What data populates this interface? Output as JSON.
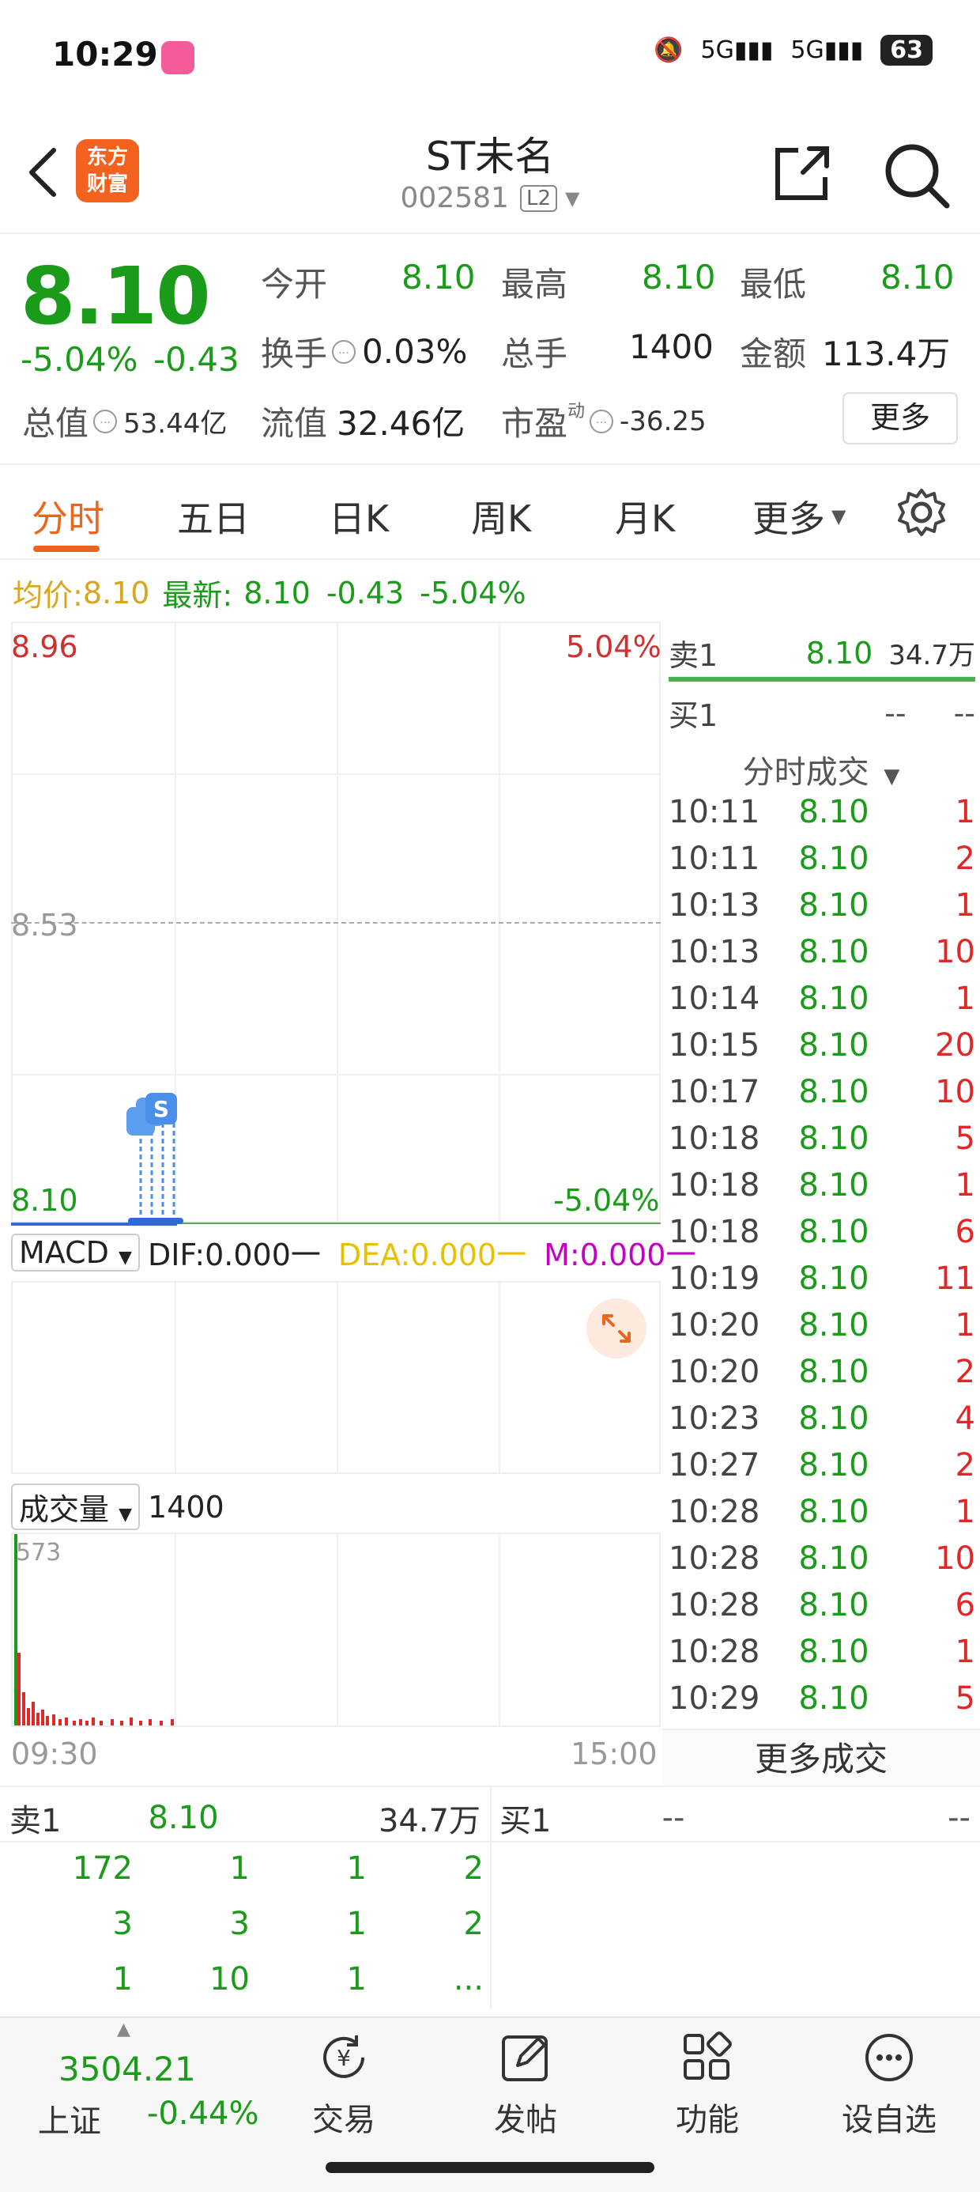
{
  "status": {
    "time": "10:29",
    "net1": "5G",
    "net2": "5G",
    "battery": "63"
  },
  "header": {
    "logo_line1": "东方",
    "logo_line2": "财富",
    "name": "ST未名",
    "code": "002581",
    "level_badge": "L2"
  },
  "quote": {
    "price": "8.10",
    "change_pct": "-5.04%",
    "change_abs": "-0.43",
    "open_label": "今开",
    "open": "8.10",
    "high_label": "最高",
    "high": "8.10",
    "low_label": "最低",
    "low": "8.10",
    "turnover_label": "换手",
    "turnover": "0.03%",
    "volume_label": "总手",
    "volume": "1400",
    "amount_label": "金额",
    "amount": "113.4万",
    "total_cap_label": "总值",
    "total_cap": "53.44亿",
    "float_cap_label": "流值",
    "float_cap": "32.46亿",
    "pe_label": "市盈",
    "pe_sup": "动",
    "pe": "-36.25",
    "more_button": "更多"
  },
  "tabs": [
    "分时",
    "五日",
    "日K",
    "周K",
    "月K",
    "更多"
  ],
  "avg_line": {
    "avg_label": "均价:",
    "avg_value": "8.10",
    "latest_label": "最新:",
    "latest_value": "8.10",
    "latest_change": "-0.43",
    "latest_pct": "-5.04%"
  },
  "chart_axis": {
    "high": "8.96",
    "high_pct": "5.04%",
    "mid": "8.53",
    "low": "8.10",
    "low_pct": "-5.04%",
    "time_start": "09:30",
    "time_end": "15:00"
  },
  "macd": {
    "selector": "MACD",
    "dif": "DIF:0.000一",
    "dea": "DEA:0.000一",
    "m": "M:0.000一"
  },
  "volume_panel": {
    "selector": "成交量",
    "value": "1400",
    "max": "573"
  },
  "order_book": {
    "sell1_label": "卖1",
    "sell1_price": "8.10",
    "sell1_vol": "34.7万",
    "buy1_label": "买1",
    "buy1_price": "--",
    "buy1_vol": "--",
    "trades_title": "分时成交",
    "trades": [
      {
        "time": "10:11",
        "price": "8.10",
        "vol": "1"
      },
      {
        "time": "10:11",
        "price": "8.10",
        "vol": "2"
      },
      {
        "time": "10:13",
        "price": "8.10",
        "vol": "1"
      },
      {
        "time": "10:13",
        "price": "8.10",
        "vol": "10"
      },
      {
        "time": "10:14",
        "price": "8.10",
        "vol": "1"
      },
      {
        "time": "10:15",
        "price": "8.10",
        "vol": "20"
      },
      {
        "time": "10:17",
        "price": "8.10",
        "vol": "10"
      },
      {
        "time": "10:18",
        "price": "8.10",
        "vol": "5"
      },
      {
        "time": "10:18",
        "price": "8.10",
        "vol": "1"
      },
      {
        "time": "10:18",
        "price": "8.10",
        "vol": "6"
      },
      {
        "time": "10:19",
        "price": "8.10",
        "vol": "11"
      },
      {
        "time": "10:20",
        "price": "8.10",
        "vol": "1"
      },
      {
        "time": "10:20",
        "price": "8.10",
        "vol": "2"
      },
      {
        "time": "10:23",
        "price": "8.10",
        "vol": "4"
      },
      {
        "time": "10:27",
        "price": "8.10",
        "vol": "2"
      },
      {
        "time": "10:28",
        "price": "8.10",
        "vol": "1"
      },
      {
        "time": "10:28",
        "price": "8.10",
        "vol": "10"
      },
      {
        "time": "10:28",
        "price": "8.10",
        "vol": "6"
      },
      {
        "time": "10:28",
        "price": "8.10",
        "vol": "1"
      },
      {
        "time": "10:29",
        "price": "8.10",
        "vol": "5"
      }
    ],
    "more_trades": "更多成交"
  },
  "bottom_book": {
    "left_label": "卖1",
    "left_price": "8.10",
    "left_vol": "34.7万",
    "right_label": "买1",
    "right_price": "--",
    "right_vol": "--",
    "queue": [
      [
        "172",
        "1",
        "1",
        "2"
      ],
      [
        "3",
        "3",
        "1",
        "2"
      ],
      [
        "1",
        "10",
        "1",
        "..."
      ]
    ]
  },
  "bottom_nav": {
    "index_value": "3504.21",
    "index_name": "上证",
    "index_change": "-0.44%",
    "items": [
      "交易",
      "发帖",
      "功能",
      "设自选"
    ]
  },
  "colors": {
    "up": "#e02828",
    "down": "#1a9b1a",
    "accent": "#e8671d",
    "avg": "#d9a620"
  }
}
